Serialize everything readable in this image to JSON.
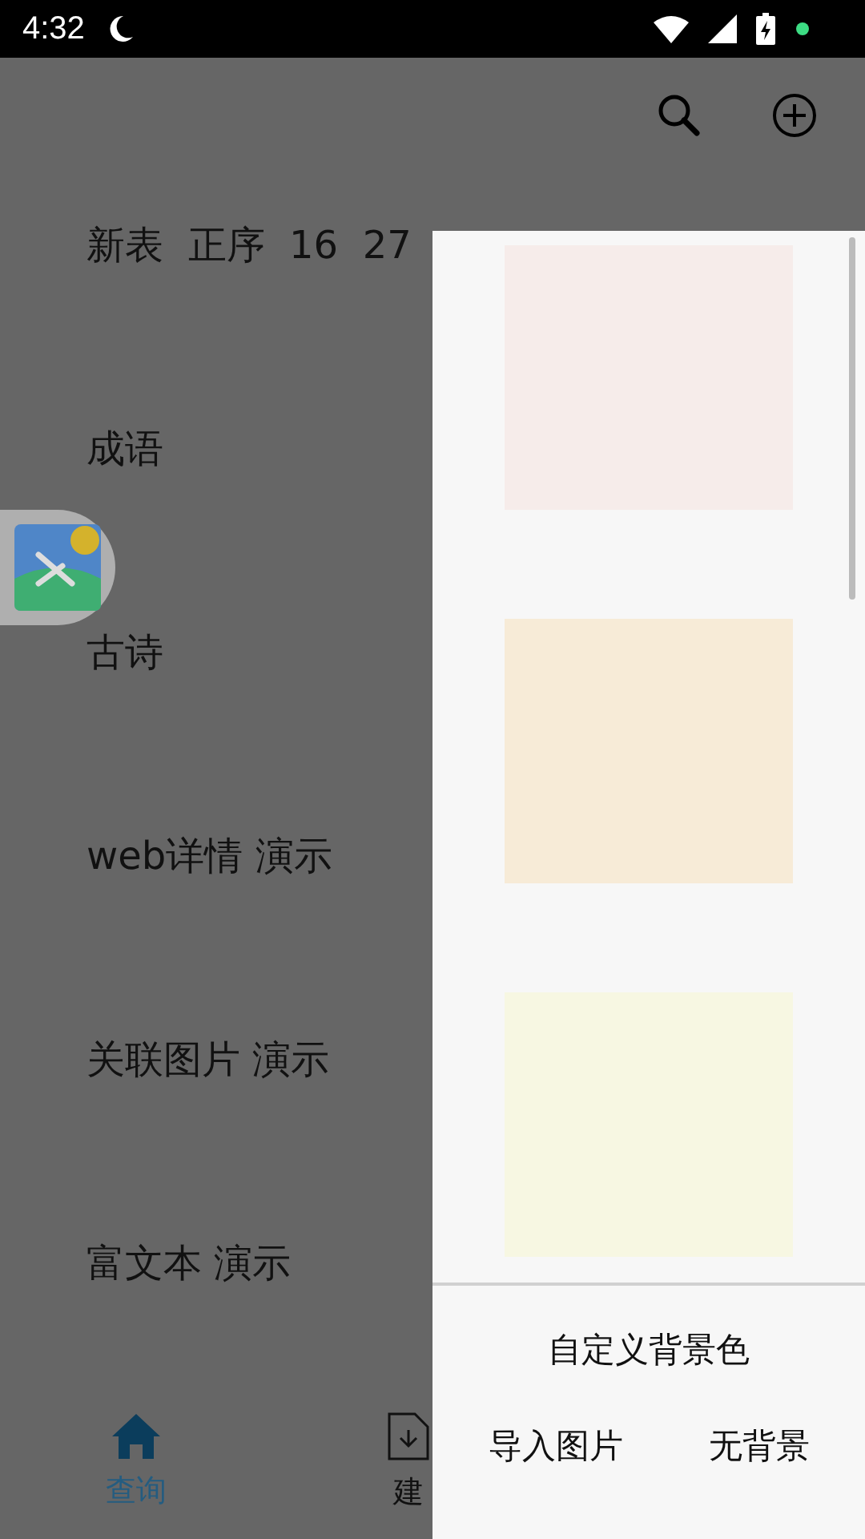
{
  "status_bar": {
    "time": "4:32"
  },
  "list": [
    {
      "title": "新表  正序  16  27"
    },
    {
      "title": "成语"
    },
    {
      "title": "古诗"
    },
    {
      "title": "web详情 演示"
    },
    {
      "title": "关联图片 演示"
    },
    {
      "title": "富文本 演示"
    }
  ],
  "bottom_nav": [
    {
      "label": "查询",
      "selected": true,
      "kind": "home"
    },
    {
      "label": "建",
      "selected": false,
      "kind": "document"
    }
  ],
  "background_panel": {
    "swatches": [
      {
        "color": "#f6ecea"
      },
      {
        "color": "#f7ebd7"
      },
      {
        "color": "#f7f7e2"
      }
    ],
    "custom_button": "自定义背景色",
    "buttons": [
      "导入图片",
      "无背景"
    ]
  }
}
